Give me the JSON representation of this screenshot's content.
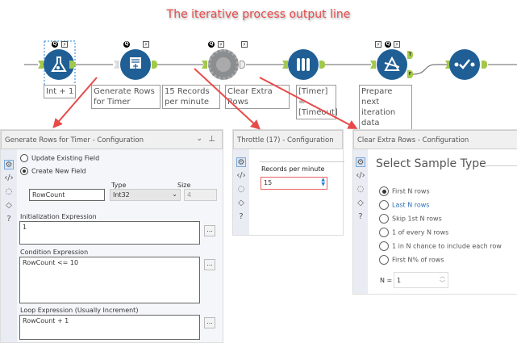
{
  "annotation": "The iterative process output line",
  "tools": [
    {
      "label": "Int + 1",
      "icon": "formula-icon"
    },
    {
      "label": "Generate Rows for Timer",
      "icon": "generate-rows-icon"
    },
    {
      "label": "15 Records per minute",
      "icon": "throttle-icon"
    },
    {
      "label": "Clear Extra Rows",
      "icon": "sample-icon"
    },
    {
      "label": "[Timer] = [Timeout]",
      "icon": "filter-icon"
    },
    {
      "label": "Prepare next iteration data",
      "icon": "select-icon"
    }
  ],
  "badges": {
    "q": "Q",
    "bolt": "⚡",
    "t": "T",
    "f": "F"
  },
  "panel1": {
    "title": "Generate Rows for Timer - Configuration",
    "update_label": "Update Existing Field",
    "create_label": "Create New  Field",
    "type_label": "Type",
    "size_label": "Size",
    "field_name": "RowCount",
    "type_value": "Int32",
    "size_value": "4",
    "init_label": "Initialization Expression",
    "init_value": "1",
    "cond_label": "Condition Expression",
    "cond_value": "RowCount <= 10",
    "loop_label": "Loop Expression (Usually Increment)",
    "loop_value": "RowCount + 1",
    "dots": "..."
  },
  "panel2": {
    "title": "Throttle (17) - Configuration",
    "records_label": "Records per minute",
    "records_value": "15"
  },
  "panel3": {
    "title": "Clear Extra Rows - Configuration",
    "heading": "Select Sample Type",
    "options": [
      "First N rows",
      "Last N rows",
      "Skip 1st N rows",
      "1 of every N rows",
      "1 in N chance to include each row",
      "First N% of rows"
    ],
    "selected": 0,
    "n_label": "N =",
    "n_value": "1"
  },
  "colors": {
    "accent": "#1f5f95",
    "anchor": "#a3c84a",
    "arrow": "#e84a4a"
  }
}
